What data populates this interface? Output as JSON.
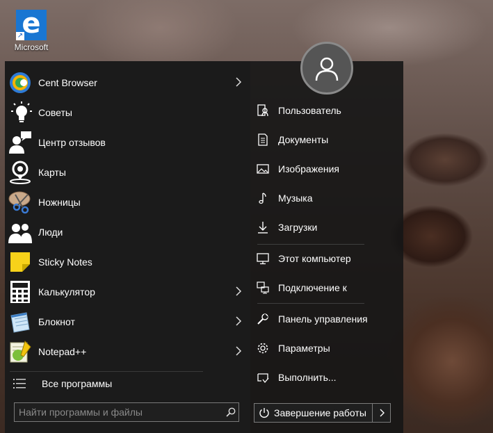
{
  "desktop": {
    "icon_caption": "Microsoft",
    "icon_glyph": "e",
    "icon_color": "#1976d2"
  },
  "start_menu": {
    "apps": [
      {
        "label": "Cent Browser",
        "icon": "cent-browser-icon",
        "has_submenu": true
      },
      {
        "label": "Советы",
        "icon": "lightbulb-icon",
        "has_submenu": false
      },
      {
        "label": "Центр отзывов",
        "icon": "feedback-hub-icon",
        "has_submenu": false
      },
      {
        "label": "Карты",
        "icon": "maps-icon",
        "has_submenu": false
      },
      {
        "label": "Ножницы",
        "icon": "scissors-icon",
        "has_submenu": false
      },
      {
        "label": "Люди",
        "icon": "people-icon",
        "has_submenu": false
      },
      {
        "label": "Sticky Notes",
        "icon": "sticky-notes-icon",
        "has_submenu": false
      },
      {
        "label": "Калькулятор",
        "icon": "calculator-icon",
        "has_submenu": true
      },
      {
        "label": "Блокнот",
        "icon": "notepad-icon",
        "has_submenu": true
      },
      {
        "label": "Notepad++",
        "icon": "notepad-plus-plus-icon",
        "has_submenu": true
      }
    ],
    "all_programs_label": "Все программы",
    "search_placeholder": "Найти программы и файлы",
    "right_items": [
      {
        "label": "Пользователь",
        "icon": "user-folder-icon"
      },
      {
        "label": "Документы",
        "icon": "documents-icon"
      },
      {
        "label": "Изображения",
        "icon": "pictures-icon"
      },
      {
        "label": "Музыка",
        "icon": "music-icon"
      },
      {
        "label": "Загрузки",
        "icon": "downloads-icon"
      },
      {
        "label": "Этот компьютер",
        "icon": "computer-icon"
      },
      {
        "label": "Подключение к",
        "icon": "connect-icon"
      },
      {
        "label": "Панель управления",
        "icon": "control-panel-icon"
      },
      {
        "label": "Параметры",
        "icon": "settings-gear-icon"
      },
      {
        "label": "Выполнить...",
        "icon": "run-icon"
      }
    ],
    "shutdown_label": "Завершение работы",
    "colors": {
      "panel_bg": "#1b1b1b",
      "sticky_yellow": "#f7d21a",
      "chrome_blue": "#1e88e5"
    }
  }
}
